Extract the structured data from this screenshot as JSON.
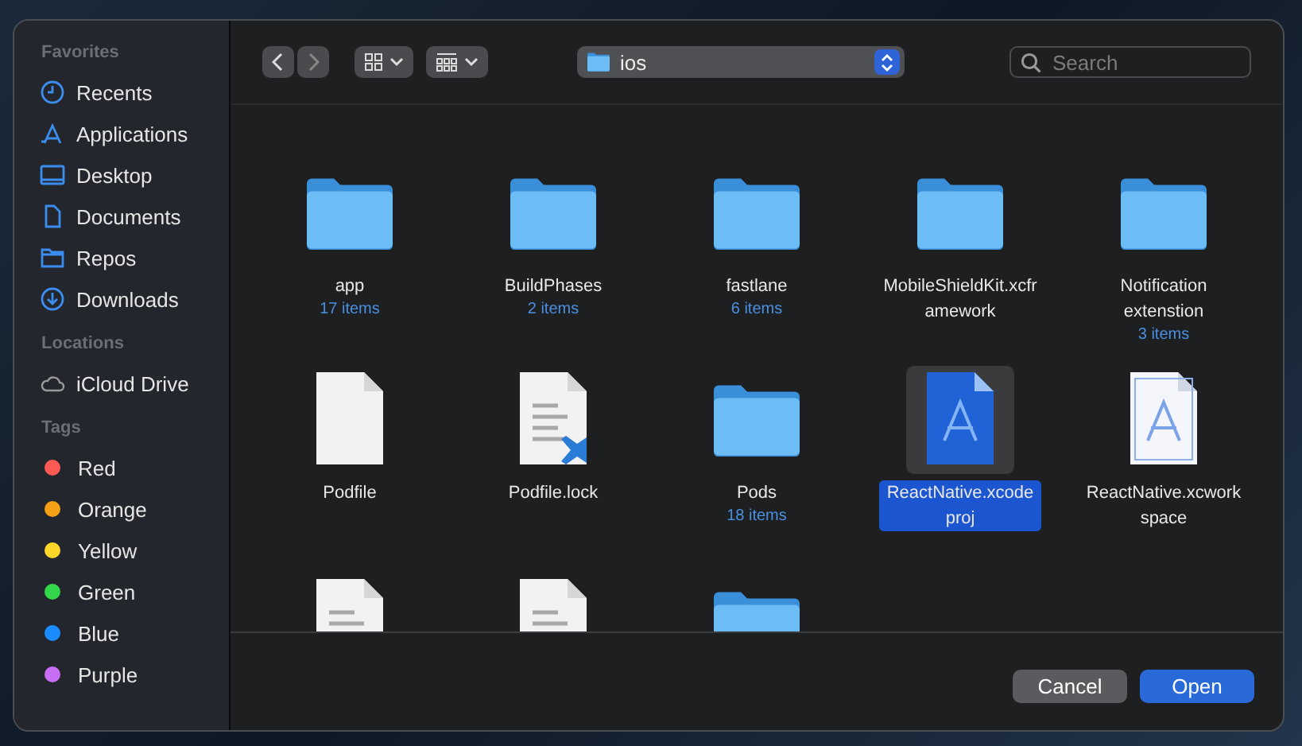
{
  "sidebar": {
    "sections": [
      {
        "title": "Favorites",
        "items": [
          {
            "label": "Recents",
            "kind": "clock"
          },
          {
            "label": "Applications",
            "kind": "apps"
          },
          {
            "label": "Desktop",
            "kind": "desktop"
          },
          {
            "label": "Documents",
            "kind": "doc"
          },
          {
            "label": "Repos",
            "kind": "folder"
          },
          {
            "label": "Downloads",
            "kind": "download"
          }
        ]
      },
      {
        "title": "Locations",
        "items": [
          {
            "label": "iCloud Drive",
            "kind": "cloud"
          }
        ]
      },
      {
        "title": "Tags",
        "items": [
          {
            "label": "Red",
            "color": "#fe5a55"
          },
          {
            "label": "Orange",
            "color": "#f5a017"
          },
          {
            "label": "Yellow",
            "color": "#fed72a"
          },
          {
            "label": "Green",
            "color": "#32d74b"
          },
          {
            "label": "Blue",
            "color": "#1a8cff"
          },
          {
            "label": "Purple",
            "color": "#c76ef5"
          }
        ]
      }
    ]
  },
  "toolbar": {
    "location": "ios",
    "search": {
      "placeholder": "Search"
    }
  },
  "files": [
    {
      "kind": "folder",
      "name": "app",
      "count": "17 items",
      "selected": false
    },
    {
      "kind": "folder",
      "name": "BuildPhases",
      "count": "2 items",
      "selected": false
    },
    {
      "kind": "folder",
      "name": "fastlane",
      "count": "6 items",
      "selected": false
    },
    {
      "kind": "folder",
      "name": "MobileShieldKit.xcframework",
      "selected": false
    },
    {
      "kind": "folder",
      "name": "Notification extenstion",
      "count": "3 items",
      "selected": false
    },
    {
      "kind": "file",
      "name": "Podfile",
      "selected": false
    },
    {
      "kind": "code",
      "name": "Podfile.lock",
      "selected": false
    },
    {
      "kind": "folder",
      "name": "Pods",
      "count": "18 items",
      "selected": false
    },
    {
      "kind": "project",
      "name": "ReactNative.xcodeproj",
      "selected": true
    },
    {
      "kind": "workspace",
      "name": "ReactNative.xcworkspace",
      "selected": false
    },
    {
      "kind": "text",
      "selected": false
    },
    {
      "kind": "text",
      "selected": false
    },
    {
      "kind": "folder",
      "selected": false
    }
  ],
  "buttons": [
    {
      "label": "Cancel",
      "kind": "secondary"
    },
    {
      "label": "Open",
      "kind": "primary"
    }
  ]
}
